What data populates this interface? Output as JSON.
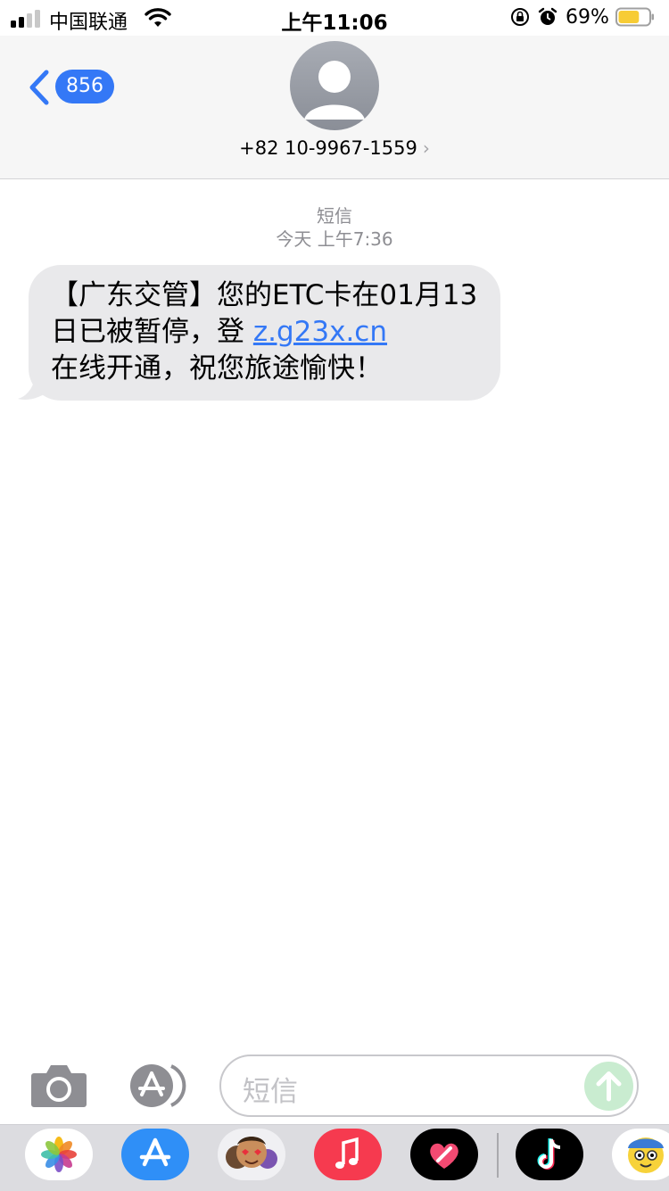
{
  "status_bar": {
    "carrier": "中国联通",
    "time": "上午11:06",
    "battery_percent": "69%",
    "battery_level": 0.69,
    "signal_bars": 2,
    "signal_total": 4
  },
  "header": {
    "back_count": "856",
    "contact": "+82 10-9967-1559",
    "chevron": "›"
  },
  "conversation": {
    "service_label": "短信",
    "timestamp": "今天 上午7:36",
    "message": {
      "text_before": "【广东交管】您的ETC卡在01月13日已被暂停，登 ",
      "link": "z.g23x.cn",
      "text_after": "在线开通，祝您旅途愉快！"
    }
  },
  "input_bar": {
    "placeholder": "短信"
  },
  "app_drawer": {
    "apps": [
      "photos-icon",
      "app-store-icon",
      "memoji-icon",
      "music-icon",
      "heart-app-icon",
      "tiktok-icon",
      "cartoon-sticker-icon"
    ]
  },
  "colors": {
    "accent": "#3478f6",
    "bubble": "#e9e9eb",
    "header_bg": "#f6f6f6",
    "secondary_text": "#8e8e93",
    "send_disabled": "#c9ecd0",
    "battery_fill": "#f7cc35"
  }
}
